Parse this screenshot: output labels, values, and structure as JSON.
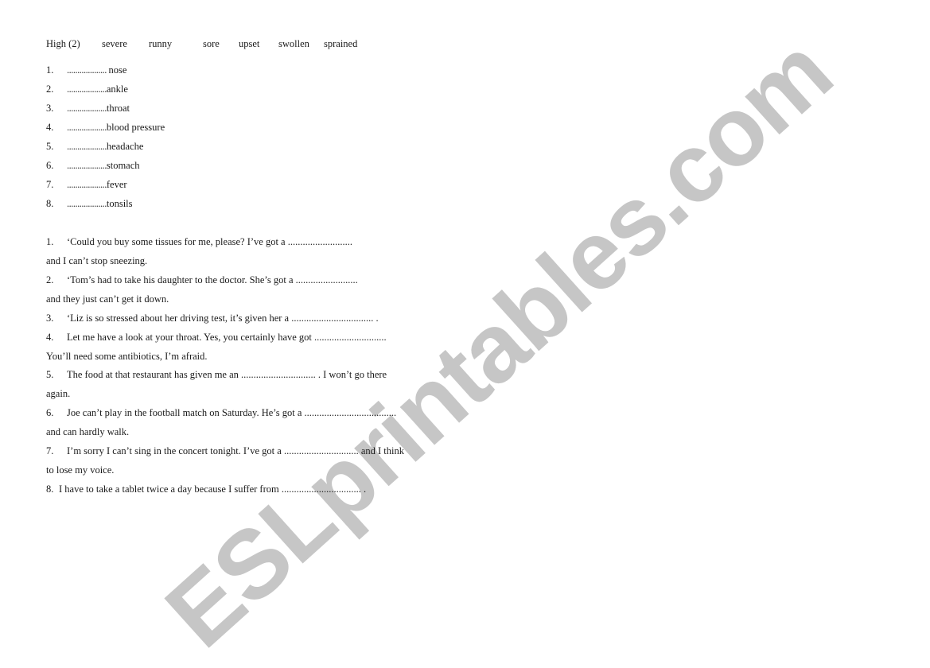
{
  "word_bank": [
    "High (2)",
    "severe",
    "runny",
    "sore",
    "upset",
    "swollen",
    "sprained"
  ],
  "matching": [
    {
      "num": "1.",
      "blank": "................... ",
      "word": "nose"
    },
    {
      "num": "2.",
      "blank": "...................",
      "word": "ankle"
    },
    {
      "num": "3.",
      "blank": "...................",
      "word": "throat"
    },
    {
      "num": "4.",
      "blank": "...................",
      "word": "blood pressure"
    },
    {
      "num": "5.",
      "blank": "...................",
      "word": "headache"
    },
    {
      "num": "6.",
      "blank": "...................",
      "word": "stomach"
    },
    {
      "num": "7.",
      "blank": "...................",
      "word": "fever"
    },
    {
      "num": "8.",
      "blank": "...................",
      "word": "tonsils"
    }
  ],
  "sentences": [
    {
      "num": "1.",
      "text": "‘Could you buy some tissues for me, please? I’ve got a ..........................",
      "cont": "and I can’t stop sneezing."
    },
    {
      "num": "2.",
      "text": "‘Tom’s had to take his daughter to the doctor. She’s got a .........................",
      "cont": "and they just can’t get it down."
    },
    {
      "num": "3.",
      "text": "‘Liz is so stressed about her driving test, it’s given her a ................................. .",
      "cont": ""
    },
    {
      "num": "4.",
      "text": "Let me have a look at your throat. Yes, you certainly have got .............................",
      "cont": "You’ll need some antibiotics, I’m afraid."
    },
    {
      "num": "5.",
      "text": "The food at that restaurant has given me an .............................. . I won’t go there",
      "cont": "again."
    },
    {
      "num": "6.",
      "text": "Joe can’t play in the football match on Saturday. He’s got a .....................................",
      "cont": "and can hardly walk."
    },
    {
      "num": "7.",
      "text": "I’m sorry I can’t sing in the concert tonight. I’ve got a .............................. and I think",
      "cont": "to lose my voice."
    },
    {
      "num": "8.",
      "text": "I have to take a tablet twice a day because I suffer from ................................ .",
      "cont": ""
    }
  ],
  "watermark": "ESLprintables.com"
}
